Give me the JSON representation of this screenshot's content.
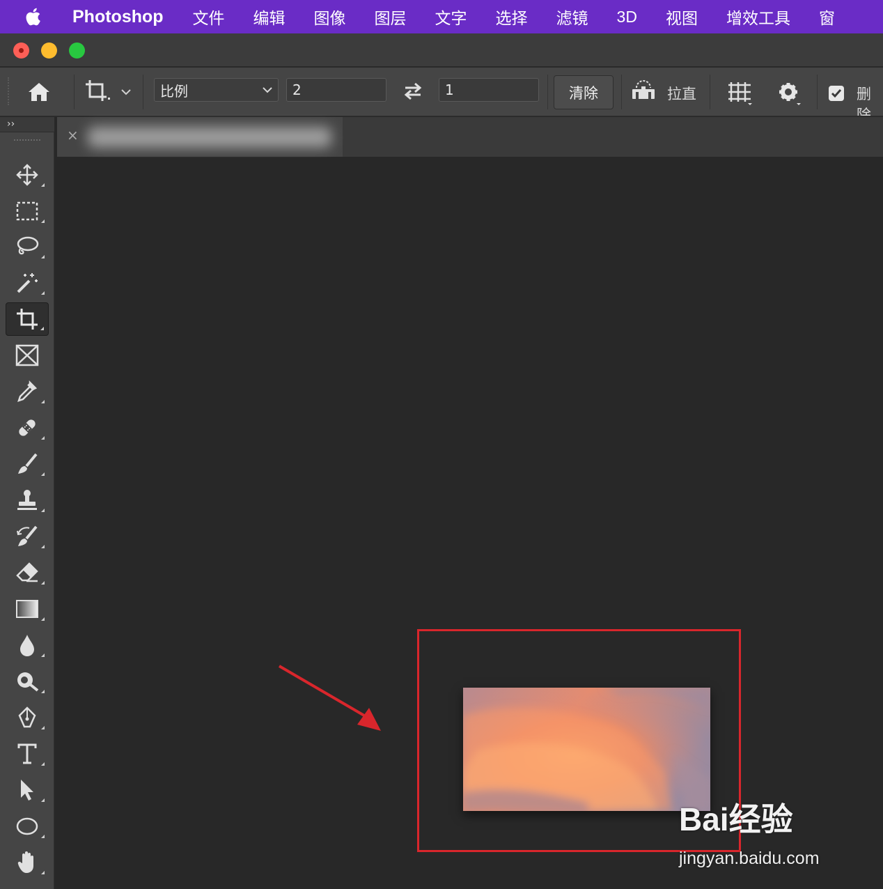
{
  "menubar": {
    "app_name": "Photoshop",
    "items": [
      "文件",
      "编辑",
      "图像",
      "图层",
      "文字",
      "选择",
      "滤镜",
      "3D",
      "视图",
      "增效工具",
      "窗"
    ]
  },
  "options_bar": {
    "ratio_select": "比例",
    "width_value": "2",
    "height_value": "1",
    "clear_label": "清除",
    "straighten_label": "拉直",
    "delete_label": "删除"
  },
  "toolbar": {
    "collapse_label": "››",
    "tools": [
      "move",
      "marquee",
      "lasso",
      "magic-wand",
      "crop",
      "frame",
      "eyedropper",
      "healing",
      "brush",
      "stamp",
      "history-brush",
      "eraser",
      "gradient",
      "blur",
      "dodge",
      "pen",
      "type",
      "path-select",
      "ellipse",
      "hand"
    ],
    "active_tool": "crop"
  },
  "document_tab": {
    "close_label": "×"
  },
  "watermark": {
    "main": "Bai经验",
    "sub": "jingyan.baidu.com"
  },
  "colors": {
    "menubar": "#6a2cc6",
    "highlight": "#d9262c",
    "canvas": "#282828"
  }
}
